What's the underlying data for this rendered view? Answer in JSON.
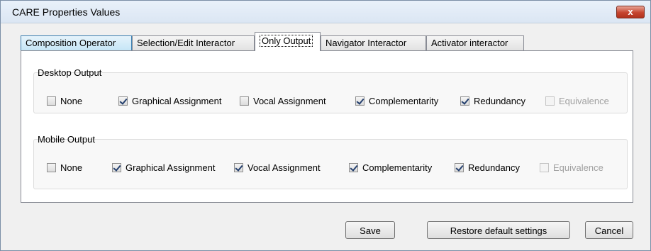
{
  "window": {
    "title": "CARE Properties Values",
    "close_label": "x"
  },
  "tabs": [
    {
      "label": "Composition Operator",
      "state": "highlight"
    },
    {
      "label": "Selection/Edit Interactor",
      "state": "normal"
    },
    {
      "label": "Only Output",
      "state": "active"
    },
    {
      "label": "Navigator Interactor",
      "state": "normal"
    },
    {
      "label": "Activator interactor",
      "state": "normal"
    }
  ],
  "desktop": {
    "title": "Desktop Output",
    "options": [
      {
        "label": "None",
        "checked": false,
        "enabled": true
      },
      {
        "label": "Graphical Assignment",
        "checked": true,
        "enabled": true
      },
      {
        "label": "Vocal Assignment",
        "checked": false,
        "enabled": true
      },
      {
        "label": "Complementarity",
        "checked": true,
        "enabled": true
      },
      {
        "label": "Redundancy",
        "checked": true,
        "enabled": true
      },
      {
        "label": "Equivalence",
        "checked": false,
        "enabled": false
      }
    ]
  },
  "mobile": {
    "title": "Mobile Output",
    "options": [
      {
        "label": "None",
        "checked": false,
        "enabled": true
      },
      {
        "label": "Graphical Assignment",
        "checked": true,
        "enabled": true
      },
      {
        "label": "Vocal Assignment",
        "checked": true,
        "enabled": true
      },
      {
        "label": "Complementarity",
        "checked": true,
        "enabled": true
      },
      {
        "label": "Redundancy",
        "checked": true,
        "enabled": true
      },
      {
        "label": "Equivalence",
        "checked": false,
        "enabled": false
      }
    ]
  },
  "buttons": {
    "save": "Save",
    "restore": "Restore default settings",
    "cancel": "Cancel"
  }
}
